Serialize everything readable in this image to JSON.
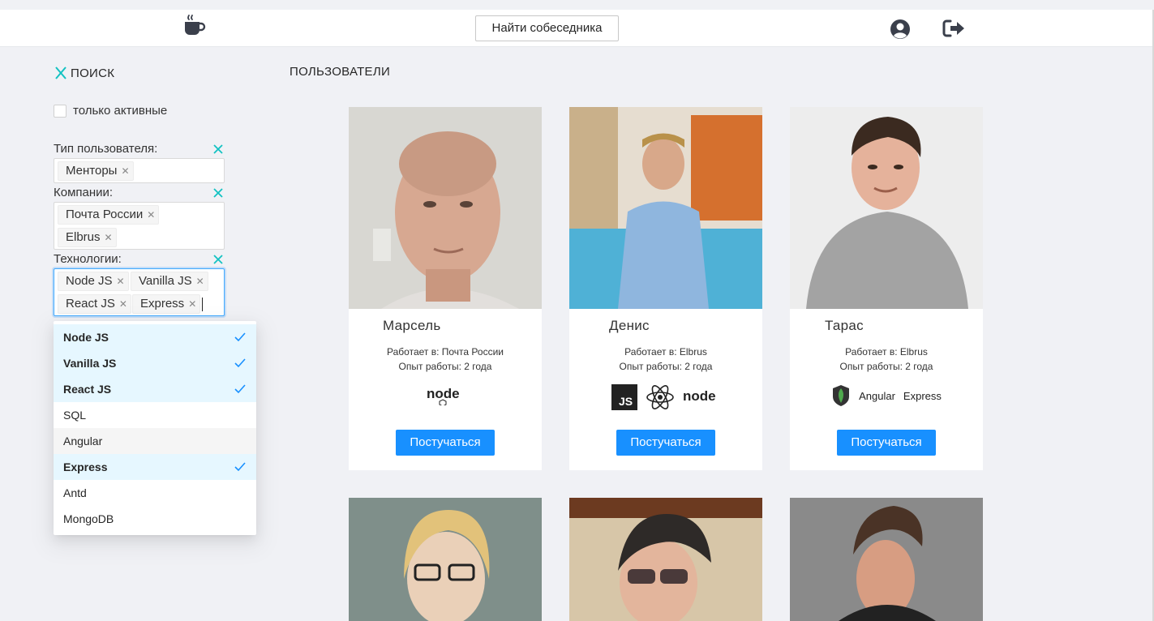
{
  "header": {
    "logo_icon": "coffee-cup-icon",
    "find_button_label": "Найти собеседника",
    "profile_icon": "user-circle-icon",
    "logout_icon": "sign-out-icon"
  },
  "sidebar": {
    "title": "ПОИСК",
    "only_active_label": "только активные",
    "user_type": {
      "label": "Тип пользователя:",
      "tags": [
        "Менторы"
      ]
    },
    "companies": {
      "label": "Компании:",
      "tags": [
        "Почта России",
        "Elbrus"
      ]
    },
    "technologies": {
      "label": "Технологии:",
      "tags": [
        "Node JS",
        "Vanilla JS",
        "React JS",
        "Express"
      ]
    },
    "dropdown": [
      {
        "label": "Node JS",
        "selected": true
      },
      {
        "label": "Vanilla JS",
        "selected": true
      },
      {
        "label": "React JS",
        "selected": true
      },
      {
        "label": "SQL",
        "selected": false
      },
      {
        "label": "Angular",
        "selected": false
      },
      {
        "label": "Express",
        "selected": true
      },
      {
        "label": "Antd",
        "selected": false
      },
      {
        "label": "MongoDB",
        "selected": false
      }
    ]
  },
  "main": {
    "title": "ПОЛЬЗОВАТЕЛИ",
    "button_label": "Постучаться",
    "users": [
      {
        "name": "Марсель",
        "works_at": "Работает в: Почта России",
        "experience": "Опыт работы: 2 года",
        "tech_icons": [
          "nodejs-logo-icon"
        ]
      },
      {
        "name": "Денис",
        "works_at": "Работает в: Elbrus",
        "experience": "Опыт работы: 2 года",
        "tech_icons": [
          "javascript-logo-icon",
          "react-logo-icon",
          "nodejs-logo-icon"
        ]
      },
      {
        "name": "Тарас",
        "works_at": "Работает в: Elbrus",
        "experience": "Опыт работы: 2 года",
        "tech_icons": [
          "mongodb-logo-icon"
        ],
        "tech_text": [
          "Angular",
          "Express"
        ]
      }
    ]
  },
  "colors": {
    "accent": "#1890ff",
    "clear_icon": "#13c2c2",
    "background": "#f0f1f5"
  }
}
